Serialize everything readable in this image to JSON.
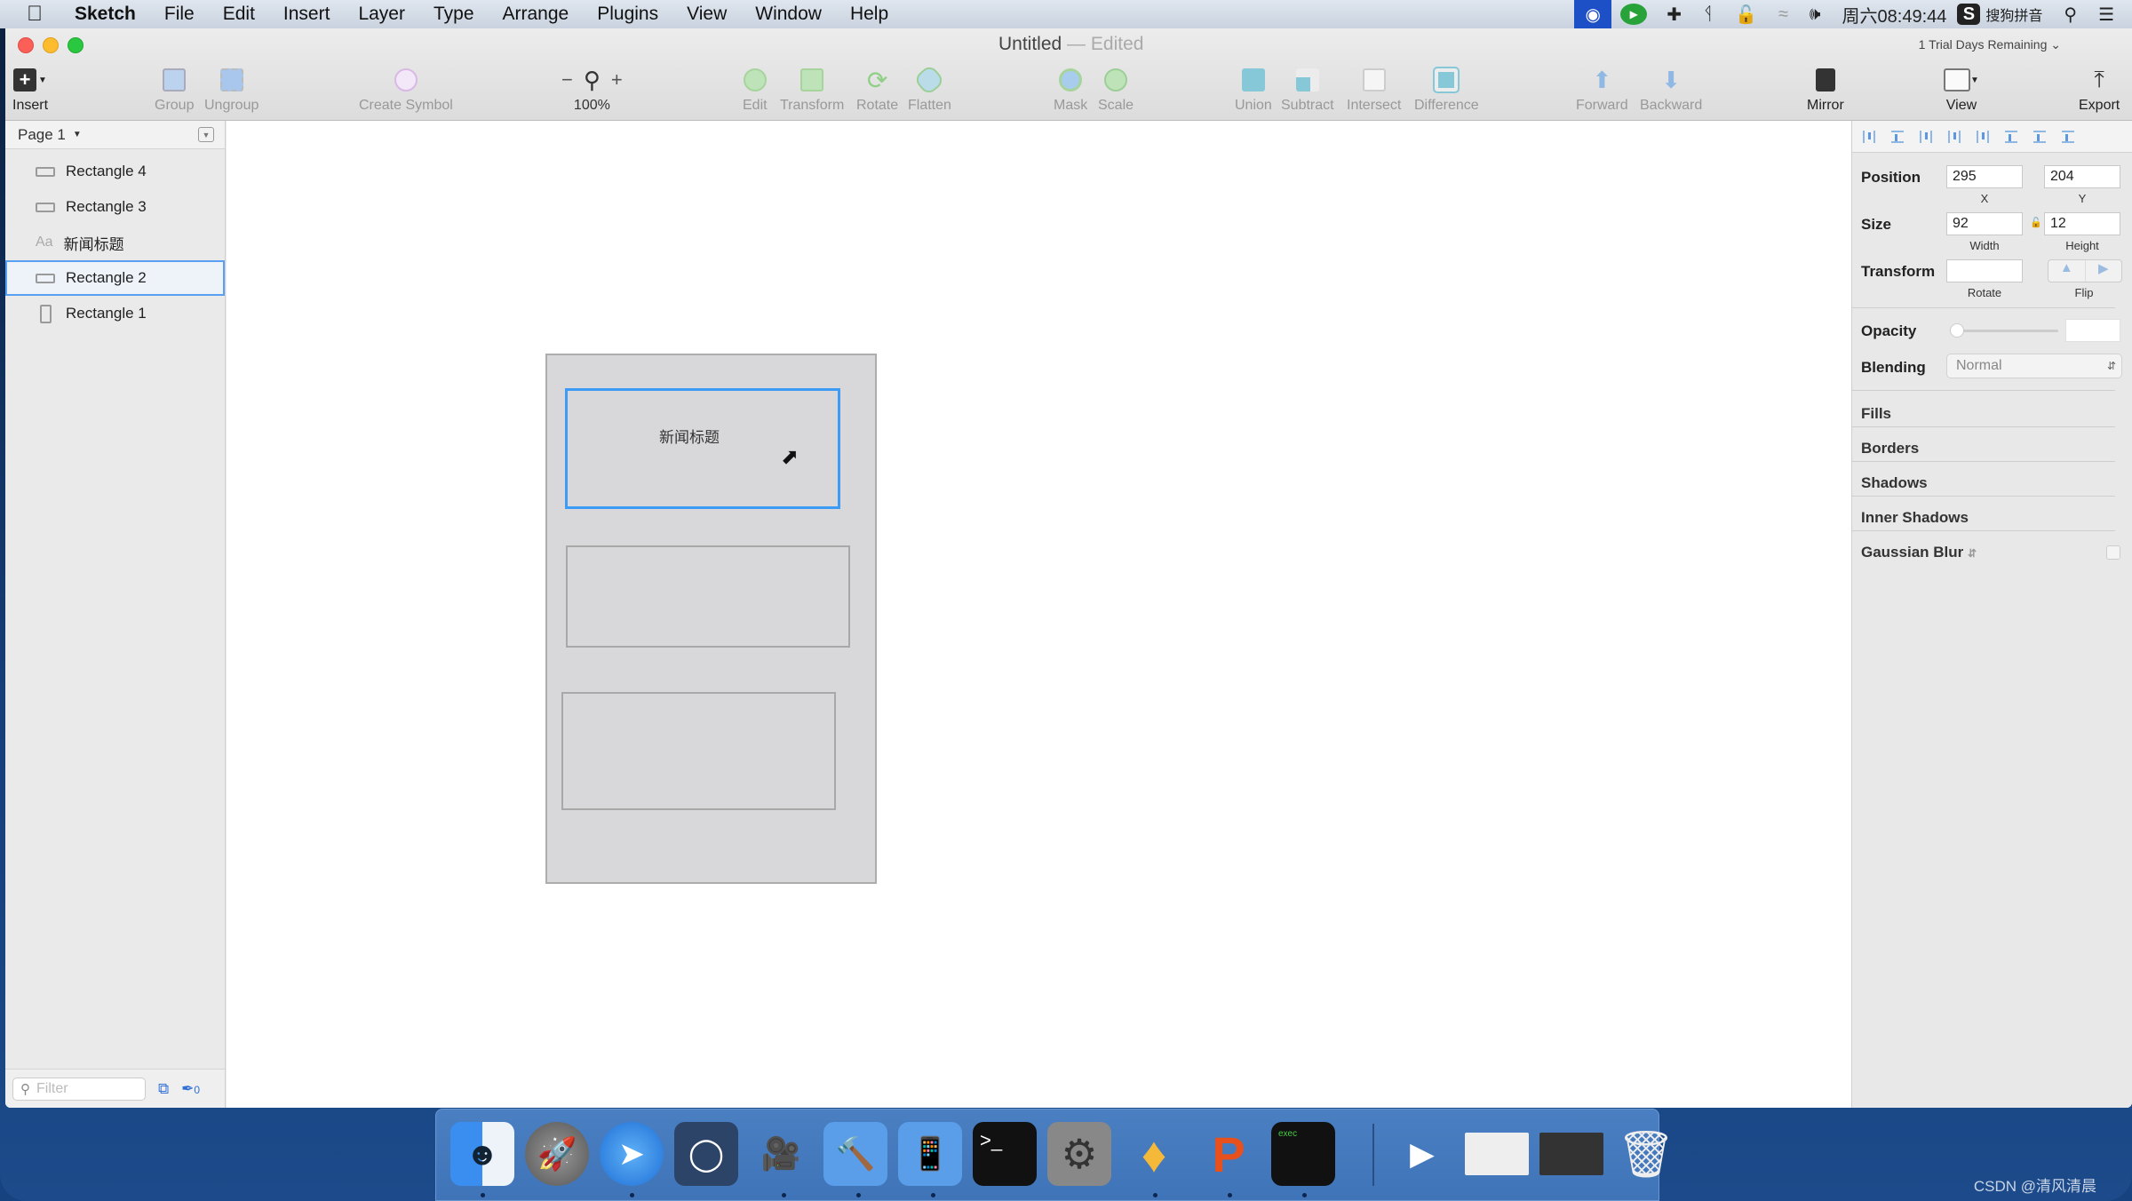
{
  "menubar": {
    "app_name": "Sketch",
    "items": [
      "File",
      "Edit",
      "Insert",
      "Layer",
      "Type",
      "Arrange",
      "Plugins",
      "View",
      "Window",
      "Help"
    ],
    "clock": "周六08:49:44",
    "input_method": "搜狗拼音",
    "status_icons": [
      "screen-record-icon",
      "play-icon",
      "move-icon",
      "bluetooth-icon",
      "lock-icon",
      "wifi-icon",
      "volume-icon",
      "sogou-icon",
      "spotlight-icon",
      "notification-list-icon"
    ]
  },
  "window": {
    "title": "Untitled",
    "title_sep": "—",
    "title_status": "Edited",
    "trial": "1 Trial Days Remaining"
  },
  "toolbar": {
    "insert": "Insert",
    "group": "Group",
    "ungroup": "Ungroup",
    "create_symbol": "Create Symbol",
    "zoom_minus": "−",
    "zoom_plus": "+",
    "zoom_level": "100%",
    "edit": "Edit",
    "transform": "Transform",
    "rotate": "Rotate",
    "flatten": "Flatten",
    "mask": "Mask",
    "scale": "Scale",
    "union": "Union",
    "subtract": "Subtract",
    "intersect": "Intersect",
    "difference": "Difference",
    "forward": "Forward",
    "backward": "Backward",
    "mirror": "Mirror",
    "view": "View",
    "export": "Export"
  },
  "sidebar": {
    "page": "Page 1",
    "layers": [
      {
        "name": "Rectangle 4",
        "type": "rect"
      },
      {
        "name": "Rectangle 3",
        "type": "rect"
      },
      {
        "name": "新闻标题",
        "type": "text",
        "icon_label": "Aa"
      },
      {
        "name": "Rectangle 2",
        "type": "rect",
        "selected": true
      },
      {
        "name": "Rectangle 1",
        "type": "rect-tall"
      }
    ],
    "filter_placeholder": "Filter",
    "slice_count": "0"
  },
  "canvas": {
    "selected_text": "新闻标题"
  },
  "inspector": {
    "position_label": "Position",
    "x": "295",
    "y": "204",
    "x_label": "X",
    "y_label": "Y",
    "size_label": "Size",
    "width": "92",
    "height": "12",
    "width_label": "Width",
    "height_label": "Height",
    "transform_label": "Transform",
    "rotate_label": "Rotate",
    "flip_label": "Flip",
    "opacity_label": "Opacity",
    "opacity_value": 0,
    "blending_label": "Blending",
    "blending_value": "Normal",
    "sections": [
      "Fills",
      "Borders",
      "Shadows",
      "Inner Shadows",
      "Gaussian Blur"
    ]
  },
  "dock": {
    "apps": [
      "Finder",
      "Launchpad",
      "Safari",
      "Mouse Utility",
      "Photo Booth / Movie",
      "Xcode",
      "Simulator",
      "Terminal",
      "System Preferences",
      "Sketch",
      "Presentation",
      "Exec",
      "Windows Media",
      "Document",
      "Screen Capture",
      "Trash"
    ]
  },
  "watermark": "CSDN @清风清晨"
}
